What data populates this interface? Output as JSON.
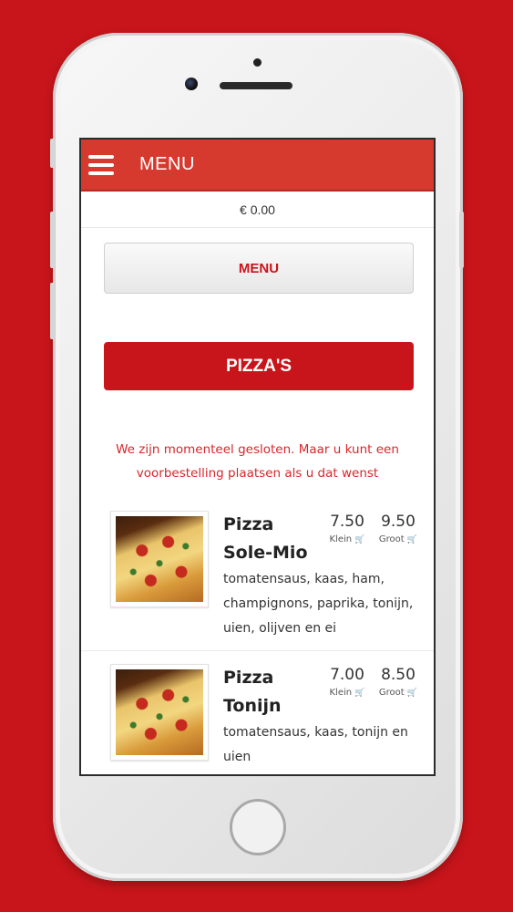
{
  "header": {
    "title": "MENU"
  },
  "cart": {
    "total": "€ 0.00"
  },
  "buttons": {
    "menu": "MENU",
    "category": "PIZZA'S"
  },
  "notice": "We zijn momenteel gesloten. Maar u kunt een voorbestelling plaatsen als u dat wenst",
  "products": [
    {
      "name": "Pizza Sole-Mio",
      "description": "tomatensaus, kaas, ham, champignons, paprika, tonijn, uien, olijven en ei",
      "price_small": "7.50",
      "price_large": "9.50",
      "label_small": "Klein",
      "label_large": "Groot"
    },
    {
      "name": "Pizza Tonijn",
      "description": "tomatensaus, kaas, tonijn en uien",
      "price_small": "7.00",
      "price_large": "8.50",
      "label_small": "Klein",
      "label_large": "Groot"
    }
  ],
  "icons": {
    "menu": "hamburger-icon",
    "cart": "cart-icon"
  },
  "colors": {
    "brand_red": "#c8151b",
    "header_red": "#d63a2e",
    "notice_red": "#d8262a"
  }
}
